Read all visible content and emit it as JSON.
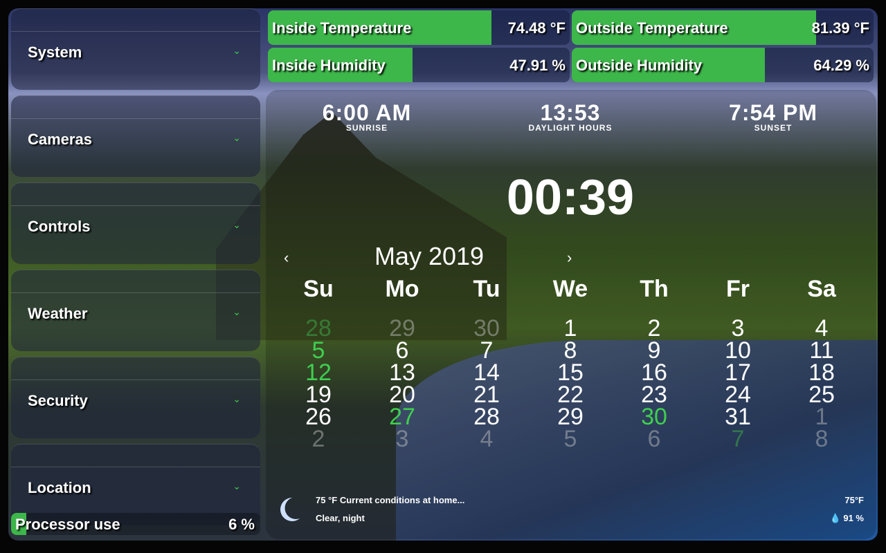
{
  "sidebar": {
    "items": [
      {
        "label": "System"
      },
      {
        "label": "Cameras"
      },
      {
        "label": "Controls"
      },
      {
        "label": "Weather"
      },
      {
        "label": "Security"
      },
      {
        "label": "Location"
      }
    ]
  },
  "sensors": [
    {
      "name": "Inside Temperature",
      "value": "74.48 °F",
      "fill_percent": 74
    },
    {
      "name": "Outside Temperature",
      "value": "81.39 °F",
      "fill_percent": 81
    },
    {
      "name": "Inside Humidity",
      "value": "47.91 %",
      "fill_percent": 48
    },
    {
      "name": "Outside Humidity",
      "value": "64.29 %",
      "fill_percent": 64
    }
  ],
  "sun": {
    "sunrise": "6:00 AM",
    "sunrise_label": "SUNRISE",
    "daylight": "13:53",
    "daylight_label": "DAYLIGHT HOURS",
    "sunset": "7:54 PM",
    "sunset_label": "SUNSET"
  },
  "clock": "00:39",
  "calendar": {
    "month": "May 2019",
    "prev": "‹",
    "next": "›",
    "weekdays": [
      "Su",
      "Mo",
      "Tu",
      "We",
      "Th",
      "Fr",
      "Sa"
    ],
    "weeks": [
      [
        "28",
        "29",
        "30",
        "1",
        "2",
        "3",
        "4"
      ],
      [
        "5",
        "6",
        "7",
        "8",
        "9",
        "10",
        "11"
      ],
      [
        "12",
        "13",
        "14",
        "15",
        "16",
        "17",
        "18"
      ],
      [
        "19",
        "20",
        "21",
        "22",
        "23",
        "24",
        "25"
      ],
      [
        "26",
        "27",
        "28",
        "29",
        "30",
        "31",
        "1"
      ],
      [
        "2",
        "3",
        "4",
        "5",
        "6",
        "7",
        "8"
      ]
    ],
    "styles": [
      [
        "og",
        "o",
        "o",
        "n",
        "n",
        "n",
        "n"
      ],
      [
        "g",
        "n",
        "n",
        "n",
        "n",
        "n",
        "n"
      ],
      [
        "g",
        "n",
        "n",
        "n",
        "n",
        "n",
        "n"
      ],
      [
        "n",
        "n",
        "n",
        "n",
        "n",
        "n",
        "n"
      ],
      [
        "n",
        "g",
        "n",
        "n",
        "g",
        "n",
        "o"
      ],
      [
        "o",
        "o",
        "o",
        "o",
        "o",
        "og",
        "o"
      ]
    ]
  },
  "weather": {
    "line1": "75 °F Current conditions at home...",
    "line2": "Clear, night",
    "temp": "75°F",
    "humidity": "91 %",
    "icon": "moon-icon"
  },
  "processor": {
    "name": "Processor use",
    "value": "6 %",
    "fill_percent": 6
  },
  "colors": {
    "accent": "#3db64a",
    "event": "#3fcf4f"
  }
}
